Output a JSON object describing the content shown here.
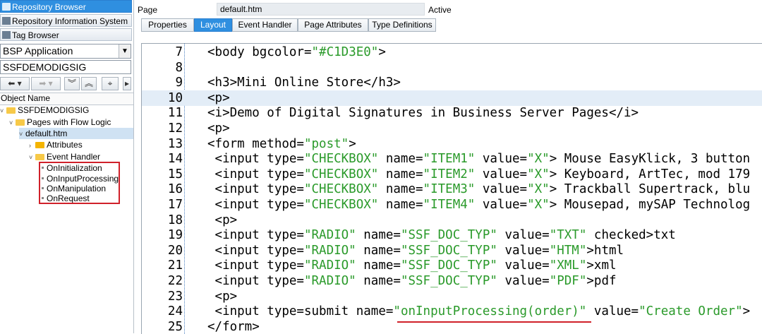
{
  "nav": {
    "repository_browser": "Repository Browser",
    "repository_info": "Repository Information System",
    "tag_browser": "Tag Browser"
  },
  "object_type": "BSP Application",
  "object_name": "SSFDEMODIGSIG",
  "tree_header": "Object Name",
  "tree": {
    "root": "SSFDEMODIGSIG",
    "pages_flow": "Pages with Flow Logic",
    "default_htm": "default.htm",
    "attributes": "Attributes",
    "event_handler": "Event Handler",
    "handlers": [
      "OnInitialization",
      "OnInputProcessing",
      "OnManipulation",
      "OnRequest"
    ]
  },
  "header": {
    "page_label": "Page",
    "page_value": "default.htm",
    "status": "Active"
  },
  "tabs": [
    "Properties",
    "Layout",
    "Event Handler",
    "Page Attributes",
    "Type Definitions"
  ],
  "active_tab": "Layout",
  "code_lines": [
    {
      "n": "7",
      "t": "<body bgcolor=\"#C1D3E0\">"
    },
    {
      "n": "8",
      "t": ""
    },
    {
      "n": "9",
      "t": "<h3>Mini Online Store</h3>"
    },
    {
      "n": "10",
      "t": "<p>"
    },
    {
      "n": "11",
      "t": "<i>Demo of Digital Signatures in Business Server Pages</i>"
    },
    {
      "n": "12",
      "t": "<p>"
    },
    {
      "n": "13",
      "t": "<form method=\"post\">"
    },
    {
      "n": "14",
      "t": " <input type=\"CHECKBOX\" name=\"ITEM1\" value=\"X\"> Mouse EasyKlick, 3 button"
    },
    {
      "n": "15",
      "t": " <input type=\"CHECKBOX\" name=\"ITEM2\" value=\"X\"> Keyboard, ArtTec, mod 179"
    },
    {
      "n": "16",
      "t": " <input type=\"CHECKBOX\" name=\"ITEM3\" value=\"X\"> Trackball Supertrack, blu"
    },
    {
      "n": "17",
      "t": " <input type=\"CHECKBOX\" name=\"ITEM4\" value=\"X\"> Mousepad, mySAP Technolog"
    },
    {
      "n": "18",
      "t": " <p>"
    },
    {
      "n": "19",
      "t": " <input type=\"RADIO\" name=\"SSF_DOC_TYP\" value=\"TXT\" checked>txt"
    },
    {
      "n": "20",
      "t": " <input type=\"RADIO\" name=\"SSF_DOC_TYP\" value=\"HTM\">html"
    },
    {
      "n": "21",
      "t": " <input type=\"RADIO\" name=\"SSF_DOC_TYP\" value=\"XML\">xml"
    },
    {
      "n": "22",
      "t": " <input type=\"RADIO\" name=\"SSF_DOC_TYP\" value=\"PDF\">pdf"
    },
    {
      "n": "23",
      "t": " <p>"
    },
    {
      "n": "24",
      "t": " <input type=submit name=\"onInputProcessing(order)\" value=\"Create Order\">"
    },
    {
      "n": "25",
      "t": "</form>"
    }
  ],
  "colors": {
    "selected_blue": "#2f8fe0",
    "string_green": "#2a9a2a",
    "highlight_red": "#d0212a"
  }
}
